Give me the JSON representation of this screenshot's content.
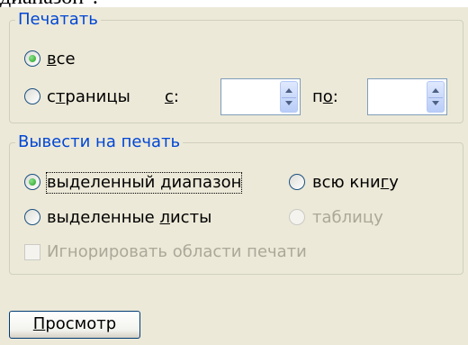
{
  "header": {
    "cutoff_text": "диапазон\"."
  },
  "print_group": {
    "legend": "Печатать",
    "all": {
      "label_u": "в",
      "label_rest": "се",
      "checked": true
    },
    "pages": {
      "label_pre": "с",
      "label_u": "т",
      "label_rest": "раницы",
      "checked": false,
      "from_label_u": "с",
      "from_label_rest": ":",
      "to_label_pre": "п",
      "to_label_u": "о",
      "to_label_rest": ":",
      "from_value": "",
      "to_value": ""
    }
  },
  "output_group": {
    "legend": "Вывести на печать",
    "selection": {
      "label_pre": "выделенный ",
      "label_u": "д",
      "label_rest": "иапазон",
      "checked": true
    },
    "workbook": {
      "label_pre": "всю кни",
      "label_u": "г",
      "label_rest": "у",
      "checked": false
    },
    "selected_sheets": {
      "label_pre": "выделенные ",
      "label_u": "л",
      "label_rest": "исты",
      "checked": false
    },
    "table": {
      "label": "таблицу",
      "checked": false,
      "enabled": false
    },
    "ignore_print_areas": {
      "label": "Игнорировать области печати",
      "checked": false,
      "enabled": false
    }
  },
  "preview_button": {
    "label_u": "П",
    "label_rest": "росмотр"
  }
}
